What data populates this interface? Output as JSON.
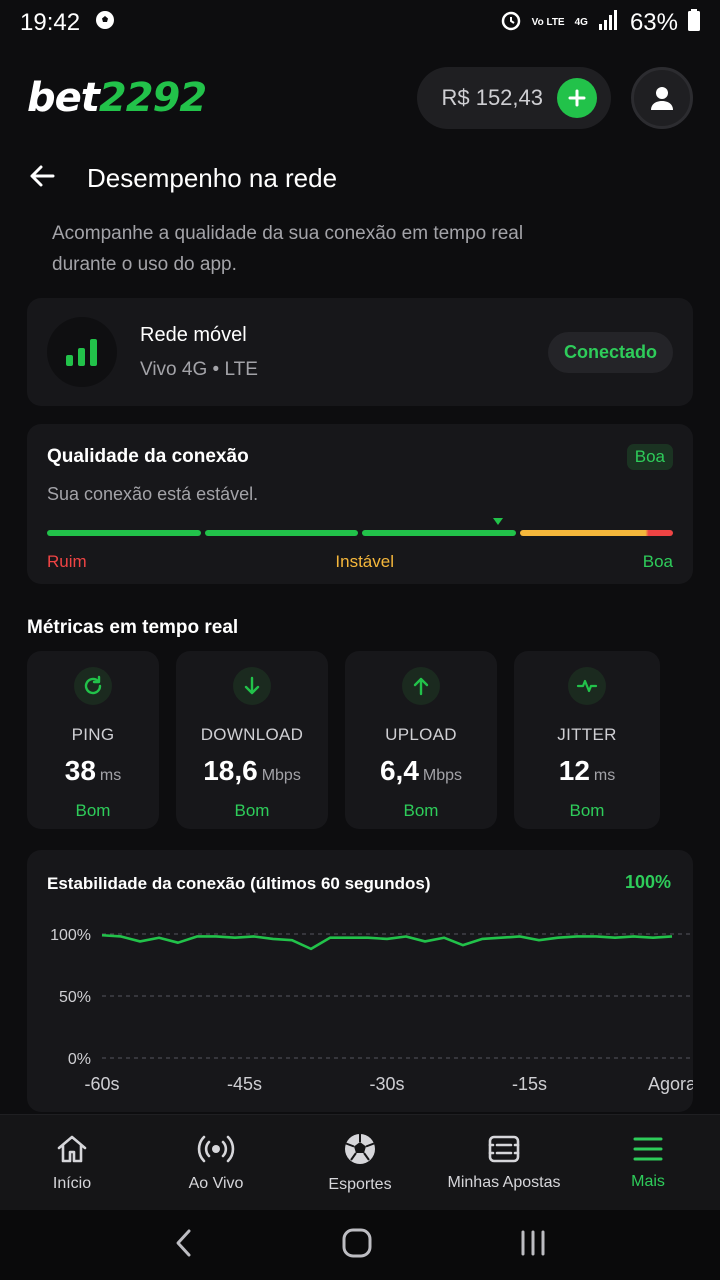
{
  "status_bar": {
    "time": "19:42",
    "network": "Vo LTE",
    "signal_label": "4G",
    "battery": "63%"
  },
  "header": {
    "logo_prefix": "bet",
    "logo_suffix": "2292",
    "balance": "R$ 152,43"
  },
  "page": {
    "title": "Desempenho na rede",
    "subtitle_line1": "Acompanhe a qualidade da sua conexão em tempo real",
    "subtitle_line2": "durante o uso do app."
  },
  "network": {
    "title": "Rede móvel",
    "subtitle": "Vivo 4G • LTE",
    "status": "Conectado"
  },
  "quality": {
    "title": "Qualidade da conexão",
    "badge": "Boa",
    "description": "Sua conexão está estável.",
    "level": 0.72,
    "labels": [
      "Ruim",
      "Instável",
      "Boa"
    ],
    "colors": {
      "bad": "#ef4444",
      "unstable": "#f5b73b",
      "good": "#22c24a"
    }
  },
  "metrics_title": "Métricas em tempo real",
  "metrics": [
    {
      "icon": "refresh-icon",
      "label": "PING",
      "value": "38",
      "unit": "ms",
      "status": "Bom"
    },
    {
      "icon": "download-icon",
      "label": "DOWNLOAD",
      "value": "18,6",
      "unit": "Mbps",
      "status": "Bom"
    },
    {
      "icon": "upload-icon",
      "label": "UPLOAD",
      "value": "6,4",
      "unit": "Mbps",
      "status": "Bom"
    },
    {
      "icon": "pulse-icon",
      "label": "JITTER",
      "value": "12",
      "unit": "ms",
      "status": "Bom"
    }
  ],
  "stability": {
    "title": "Estabilidade da conexão (últimos 60 segundos)",
    "current": "100%"
  },
  "chart_data": {
    "type": "line",
    "title": "Estabilidade da conexão (últimos 60 segundos)",
    "x_ticks": [
      "-60s",
      "-45s",
      "-30s",
      "-15s",
      "Agora"
    ],
    "y_ticks": [
      "100%",
      "50%",
      "0%"
    ],
    "ylim": [
      0,
      100
    ],
    "xlim": [
      -60,
      0
    ],
    "grid": true,
    "x": [
      -60,
      -58,
      -56,
      -54,
      -52,
      -50,
      -48,
      -46,
      -44,
      -42,
      -40,
      -38,
      -36,
      -34,
      -32,
      -30,
      -28,
      -26,
      -24,
      -22,
      -20,
      -18,
      -16,
      -14,
      -12,
      -10,
      -8,
      -6,
      -4,
      -2,
      0
    ],
    "values": [
      99,
      98,
      94,
      97,
      93,
      98,
      98,
      97,
      98,
      96,
      95,
      88,
      97,
      97,
      97,
      96,
      98,
      94,
      97,
      91,
      96,
      97,
      98,
      95,
      97,
      98,
      98,
      97,
      98,
      97,
      98
    ]
  },
  "nav": {
    "items": [
      {
        "label": "Início",
        "icon": "home-icon"
      },
      {
        "label": "Ao Vivo",
        "icon": "live-icon"
      },
      {
        "label": "Esportes",
        "icon": "soccer-ball-icon"
      },
      {
        "label": "Minhas Apostas",
        "icon": "ticket-icon"
      },
      {
        "label": "Mais",
        "icon": "menu-icon"
      }
    ],
    "active_color": "#2ecc5a"
  }
}
